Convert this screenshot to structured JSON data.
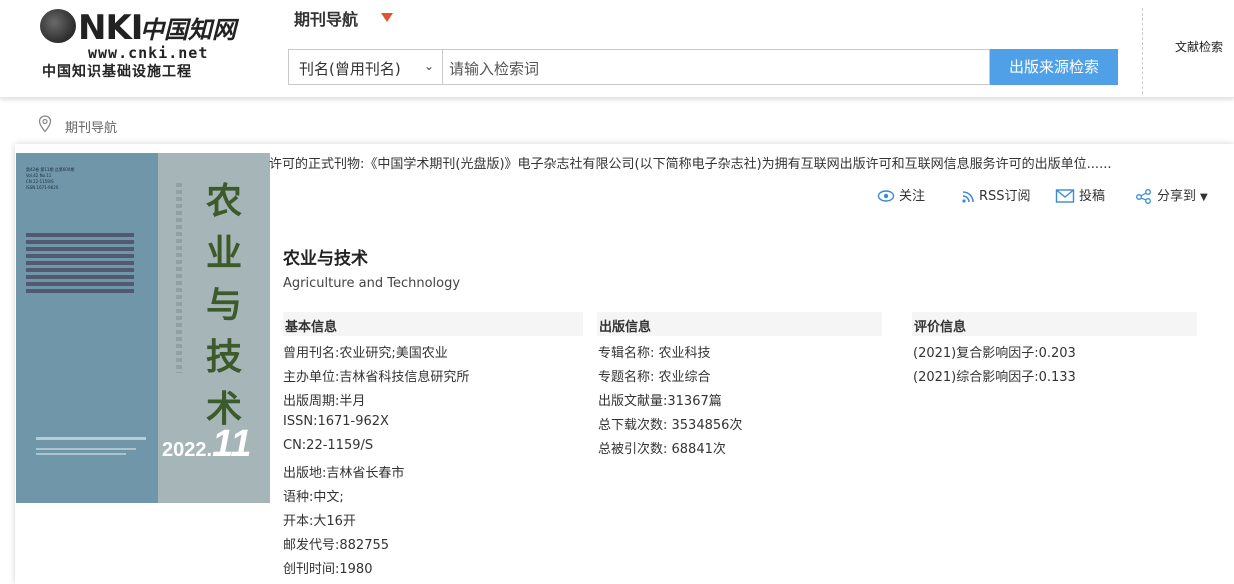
{
  "header": {
    "logo": {
      "brand": "CNKI",
      "zh": "中国知网",
      "url": "www.cnki.net",
      "sub": "中国知识基础设施工程"
    },
    "nav_title": "期刊导航",
    "search_select": "刊名(曾用刊名)",
    "search_placeholder": "请输入检索词",
    "search_button": "出版来源检索",
    "doc_search": "文献检索",
    "accent": "#4fa0e6",
    "arrow_color": "#e0552b"
  },
  "breadcrumb": "期刊导航",
  "notice": "许可的正式刊物:《中国学术期刊(光盘版)》电子杂志社有限公司(以下简称电子杂志社)为拥有互联网出版许可和互联网信息服务许可的出版单位......",
  "actions": {
    "follow": "关注",
    "rss": "RSS订阅",
    "submit": "投稿",
    "share": "分享到"
  },
  "cover": {
    "title_chars": [
      "农",
      "业",
      "与",
      "技",
      "术"
    ],
    "year": "2022.",
    "issue": "11",
    "header_lines": [
      "第42卷 第11期 总第600期",
      "Vol.42 No.11",
      "CN 22-1159/S",
      "ISSN 1671-962X"
    ]
  },
  "journal": {
    "title": "农业与技术",
    "title_en": "Agriculture and Technology"
  },
  "basic_info": {
    "heading": "基本信息",
    "rows": [
      "曾用刊名:农业研究;美国农业",
      "主办单位:吉林省科技信息研究所",
      "出版周期:半月",
      "ISSN:1671-962X",
      "CN:22-1159/S",
      "出版地:吉林省长春市",
      "语种:中文;",
      "开本:大16开",
      "邮发代号:882755",
      "创刊时间:1980"
    ]
  },
  "pub_info": {
    "heading": "出版信息",
    "rows": [
      "专辑名称:  农业科技",
      "专题名称:  农业综合",
      "出版文献量:31367篇",
      "总下载次数:  3534856次",
      "总被引次数:  68841次"
    ]
  },
  "eval_info": {
    "heading": "评价信息",
    "rows": [
      "(2021)复合影响因子:0.203",
      "(2021)综合影响因子:0.133"
    ]
  }
}
